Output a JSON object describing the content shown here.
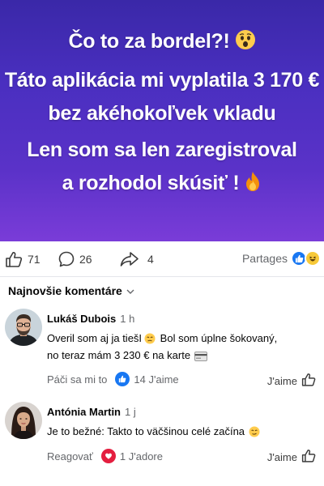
{
  "post": {
    "lines": [
      "Čo to za bordel?!",
      "Táto aplikácia mi vyplatila 3 170 €",
      "bez akéhokoľvek vkladu",
      "Len som sa len zaregistroval",
      "a rozhodol skúsiť !"
    ],
    "title_emoji": "astonished-face-emoji",
    "end_emoji": "fire-emoji",
    "gradient_top": "#3a28a8",
    "gradient_bottom": "#7a3cd8"
  },
  "actions": {
    "likes": "71",
    "comments": "26",
    "shares": "4",
    "partages_label": "Partages"
  },
  "comments_header": {
    "sort_label": "Najnovšie komentáre"
  },
  "comments": [
    {
      "name": "Lukáš Dubois",
      "time": "1 h",
      "text_line1": "Overil som aj ja tiešI",
      "text_line1_suffix": "Bol som úplne šokovaný,",
      "text_line2": "no teraz mám 3 230 € na karte",
      "like_action": "Páči sa mi to",
      "reaction_count": "14 J'aime",
      "right_label": "J'aime"
    },
    {
      "name": "Antónia Martin",
      "time": "1 j",
      "text_line1": "Je to bežné: Takto to väčšinou celé začína",
      "like_action": "Reagovať",
      "reaction_count": "1 J'adore",
      "right_label": "J'aime"
    }
  ],
  "colors": {
    "facebook_blue": "#1877f2",
    "heart_red": "#e41e3f",
    "muted_text": "#65676b"
  }
}
